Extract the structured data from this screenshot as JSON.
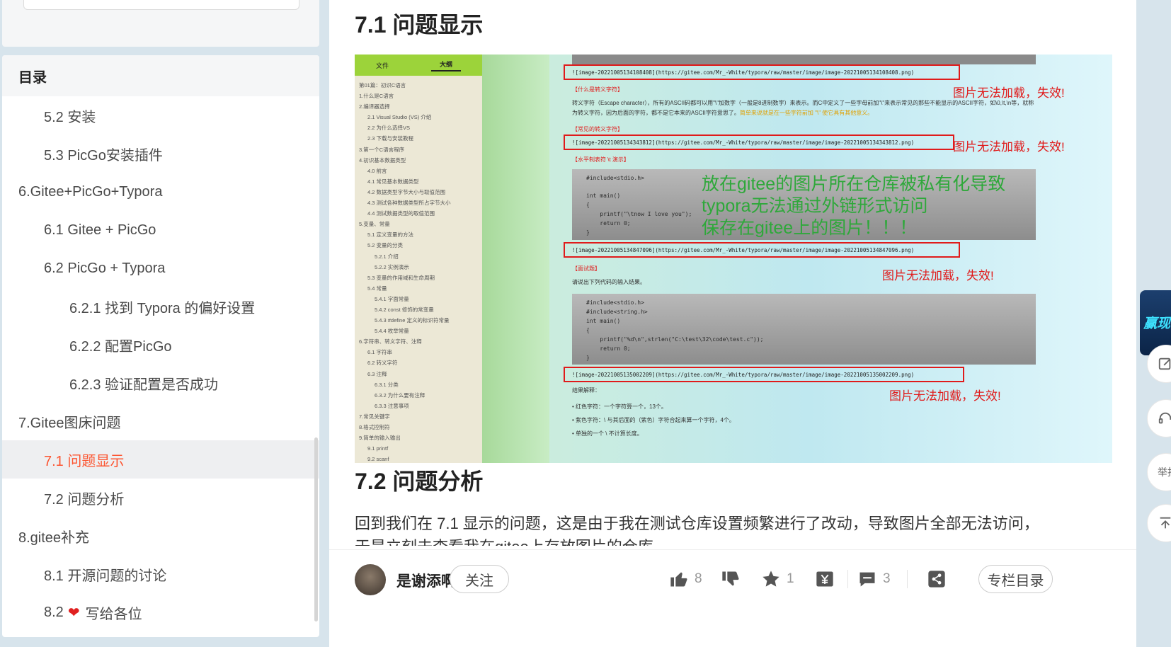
{
  "toc": {
    "title": "目录",
    "items": [
      {
        "label": "5.2 安装",
        "level": 2,
        "active": false
      },
      {
        "label": "5.3 PicGo安装插件",
        "level": 2,
        "active": false
      },
      {
        "label": "6.Gitee+PicGo+Typora",
        "level": 1,
        "active": false
      },
      {
        "label": "6.1 Gitee + PicGo",
        "level": 2,
        "active": false
      },
      {
        "label": "6.2 PicGo + Typora",
        "level": 2,
        "active": false
      },
      {
        "label": "6.2.1 找到 Typora 的偏好设置",
        "level": 3,
        "active": false
      },
      {
        "label": "6.2.2 配置PicGo",
        "level": 3,
        "active": false
      },
      {
        "label": "6.2.3 验证配置是否成功",
        "level": 3,
        "active": false
      },
      {
        "label": "7.Gitee图床问题",
        "level": 1,
        "active": false
      },
      {
        "label": "7.1 问题显示",
        "level": 2,
        "active": true
      },
      {
        "label": "7.2 问题分析",
        "level": 2,
        "active": false
      },
      {
        "label": "8.gitee补充",
        "level": 1,
        "active": false
      },
      {
        "label": "8.1 开源问题的讨论",
        "level": 2,
        "active": false
      }
    ],
    "last_item": {
      "prefix": "8.2",
      "suffix": "写给各位"
    }
  },
  "article": {
    "heading_71": "7.1 问题显示",
    "heading_72": "7.2 问题分析",
    "body_line1": "回到我们在 7.1 显示的问题，这是由于我在测试仓库设置频繁进行了改动，导致图片全部无法访问，",
    "body_line2": "于是立刻去查看我在gitee上存放图片的仓库"
  },
  "screenshot": {
    "tabs": [
      "文件",
      "大纲"
    ],
    "outline": [
      {
        "t": "第01篇：初识C语言",
        "l": 1
      },
      {
        "t": "1.什么是C语言",
        "l": 1
      },
      {
        "t": "2.编译器选择",
        "l": 1
      },
      {
        "t": "2.1 Visual Studio (VS) 介绍",
        "l": 2
      },
      {
        "t": "2.2 为什么选择VS",
        "l": 2
      },
      {
        "t": "2.3 下载与安装教程",
        "l": 2
      },
      {
        "t": "3.第一个C语言程序",
        "l": 1
      },
      {
        "t": "4.初识基本数据类型",
        "l": 1
      },
      {
        "t": "4.0 前言",
        "l": 2
      },
      {
        "t": "4.1 常见基本数据类型",
        "l": 2
      },
      {
        "t": "4.2 数据类型字节大小与取值范围",
        "l": 2
      },
      {
        "t": "4.3 测试各种数据类型所占字节大小",
        "l": 2
      },
      {
        "t": "4.4 测试数据类型的取值范围",
        "l": 2
      },
      {
        "t": "5.变量、常量",
        "l": 1
      },
      {
        "t": "5.1 定义变量的方法",
        "l": 2
      },
      {
        "t": "5.2 变量的分类",
        "l": 2
      },
      {
        "t": "5.2.1 介绍",
        "l": 3
      },
      {
        "t": "5.2.2 实例演示",
        "l": 3
      },
      {
        "t": "5.3 变量的作用域和生命周期",
        "l": 2
      },
      {
        "t": "5.4 常量",
        "l": 2
      },
      {
        "t": "5.4.1 字面常量",
        "l": 3
      },
      {
        "t": "5.4.2 const 修饰的常变量",
        "l": 3
      },
      {
        "t": "5.4.3 #define 定义的标识符常量",
        "l": 3
      },
      {
        "t": "5.4.4 枚举常量",
        "l": 3
      },
      {
        "t": "6.字符串、转义字符、注释",
        "l": 1
      },
      {
        "t": "6.1 字符串",
        "l": 2
      },
      {
        "t": "6.2 转义字符",
        "l": 2
      },
      {
        "t": "6.3 注释",
        "l": 2
      },
      {
        "t": "6.3.1 分类",
        "l": 3
      },
      {
        "t": "6.3.2 为什么要有注释",
        "l": 3
      },
      {
        "t": "6.3.3 注意事项",
        "l": 3
      },
      {
        "t": "7.常见关键字",
        "l": 1
      },
      {
        "t": "8.格式控制符",
        "l": 1
      },
      {
        "t": "9.简单的输入输出",
        "l": 1
      },
      {
        "t": "9.1 printf",
        "l": 2
      },
      {
        "t": "9.2 scanf",
        "l": 2
      }
    ],
    "links": [
      "![image-20221005134108408](https://gitee.com/Mr_-White/typora/raw/master/image/image-20221005134108408.png)",
      "![image-20221005134343812](https://gitee.com/Mr_-White/typora/raw/master/image/image-20221005134343812.png)",
      "![image-20221005134847096](https://gitee.com/Mr_-White/typora/raw/master/image/image-20221005134847096.png)",
      "![image-20221005135002209](https://gitee.com/Mr_-White/typora/raw/master/image/image-20221005135002209.png)"
    ],
    "fail_text": "图片无法加载，失效!",
    "labels": [
      "【什么是转义字符】",
      "【常见的转义字符】",
      "【水平制表符 \\t 演示】",
      "【面试题】"
    ],
    "para1": "转义字符（Escape character），所有的ASCII码都可以用\"\\\"加数字（一般是8进制数字）来表示。而C中定义了一些字母前加\"\\\"来表示常见的那些不能显示的ASCII字符，如\\0,\\t,\\n等，就称为转义字符，因为后面的字符，都不是它本来的ASCII字符意思了。",
    "para1_tail": "简单来说就是在一些字符前加 \"\\\" 使它具有其他意义。",
    "question": "请说出下列代码的输入结果。",
    "code1": [
      "#include<stdio.h>",
      "",
      "int main()",
      "{",
      "    printf(\"\\tnow I love you\");",
      "    return 0;",
      "}"
    ],
    "code2": [
      "#include<stdio.h>",
      "#include<string.h>",
      "int main()",
      "{",
      "    printf(\"%d\\n\",strlen(\"C:\\test\\32\\code\\test.c\"));",
      "    return 0;",
      "}"
    ],
    "result_label": "结果解释：",
    "bullets": [
      "红色字符：一个字符算一个，13个。",
      "紫色字符：\\ 与其后面的（紫色）字符合起来算一个字符，4个。",
      "单独的一个 \\ 不计算长度。"
    ],
    "overlay": [
      "放在gitee的图片所在仓库被私有化导致",
      "typora无法通过外链形式访问",
      "保存在gitee上的图片！！！"
    ]
  },
  "toolbar": {
    "author": "是谢添啊",
    "follow": "关注",
    "likes": "8",
    "favorites": "1",
    "comments": "3",
    "catalog": "专栏目录"
  },
  "right_rail": {
    "promo": "赢现",
    "report": "举报"
  },
  "colors": {
    "accent": "#fc5531",
    "fail_red": "#e01b1b",
    "overlay_green": "#2ea83a"
  }
}
